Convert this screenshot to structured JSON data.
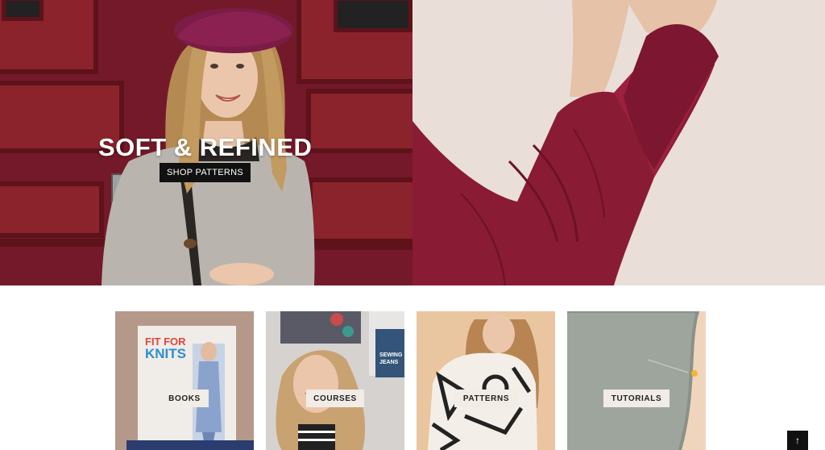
{
  "hero": {
    "title": "SOFT & REFINED",
    "cta_label": "SHOP PATTERNS"
  },
  "categories": [
    {
      "label": "BOOKS",
      "image": "book-cover-fit-for-knits",
      "book_title_line1": "FIT FOR",
      "book_title_line2": "KNITS"
    },
    {
      "label": "COURSES",
      "image": "smiling-woman-sewing-jeans-book",
      "book_title_line1": "SEWING",
      "book_title_line2": "JEANS"
    },
    {
      "label": "PATTERNS",
      "image": "woman-in-patterned-top"
    },
    {
      "label": "TUTORIALS",
      "image": "grey-knit-fabric-with-pin"
    }
  ],
  "scroll_top": {
    "icon": "arrow-up-icon",
    "glyph": "↑"
  },
  "colors": {
    "door_red": "#7d1d26",
    "sleeve_burgundy": "#8e1c36",
    "cta_black": "#111111"
  }
}
